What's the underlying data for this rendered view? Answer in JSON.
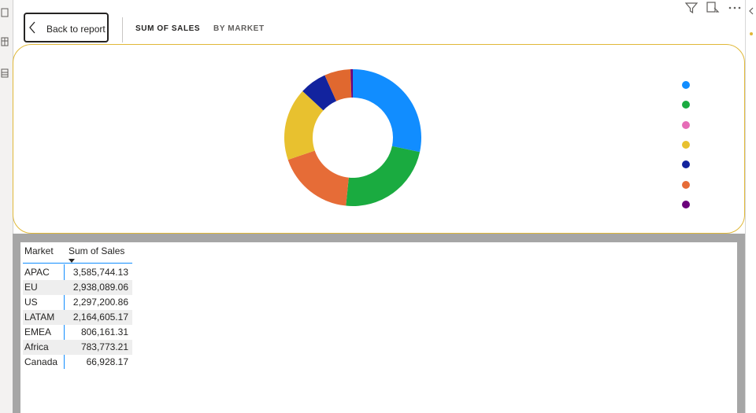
{
  "nav": {
    "back_label": "Back to report",
    "crumbs": [
      "SUM OF SALES",
      "BY MARKET"
    ]
  },
  "icons": {
    "chevron": "chevron-left-icon",
    "filter": "filter-icon",
    "focus": "focus-mode-icon",
    "more": "more-options-icon"
  },
  "chart_data": {
    "type": "pie",
    "variant": "donut",
    "categories": [
      "APAC",
      "EU",
      "US",
      "LATAM",
      "EMEA",
      "Africa",
      "Canada"
    ],
    "values": [
      3585744.13,
      2938089.06,
      2297200.86,
      2164605.17,
      806161.31,
      783773.21,
      66928.17
    ],
    "colors": [
      "#118dff",
      "#1aab40",
      "#e66c37",
      "#e8c12f",
      "#12239e",
      "#e0682f",
      "#6b007b"
    ],
    "legend_position": "right"
  },
  "table": {
    "headers": [
      "Market",
      "Sum of Sales"
    ],
    "rows": [
      [
        "APAC",
        "3,585,744.13"
      ],
      [
        "EU",
        "2,938,089.06"
      ],
      [
        "US",
        "2,297,200.86"
      ],
      [
        "LATAM",
        "2,164,605.17"
      ],
      [
        "EMEA",
        "806,161.31"
      ],
      [
        "Africa",
        "783,773.21"
      ],
      [
        "Canada",
        "66,928.17"
      ]
    ]
  }
}
